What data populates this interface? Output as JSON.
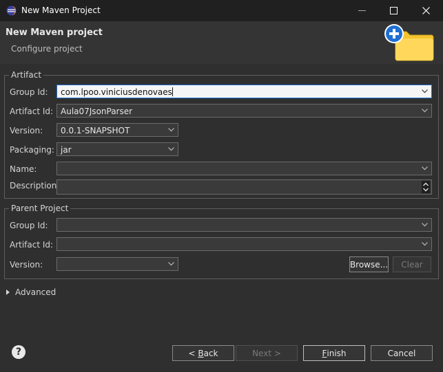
{
  "window": {
    "title": "New Maven Project",
    "minimize_glyph": "—",
    "close_glyph": "✕"
  },
  "header": {
    "title": "New Maven project",
    "subtitle": "Configure project"
  },
  "artifact": {
    "legend": "Artifact",
    "group_id_label": "Group Id:",
    "group_id_value": "com.lpoo.viniciusdenovaes",
    "artifact_id_label": "Artifact Id:",
    "artifact_id_value": "Aula07JsonParser",
    "version_label": "Version:",
    "version_value": "0.0.1-SNAPSHOT",
    "packaging_label": "Packaging:",
    "packaging_value": "jar",
    "name_label": "Name:",
    "name_value": "",
    "description_label": "Description:",
    "description_value": ""
  },
  "parent": {
    "legend": "Parent Project",
    "group_id_label": "Group Id:",
    "group_id_value": "",
    "artifact_id_label": "Artifact Id:",
    "artifact_id_value": "",
    "version_label": "Version:",
    "version_value": "",
    "browse_label": "Browse...",
    "clear_label": "Clear"
  },
  "advanced": {
    "label": "Advanced"
  },
  "footer": {
    "help_glyph": "?",
    "back_prefix": "< ",
    "back_mnemonic": "B",
    "back_rest": "ack",
    "next_label": "Next >",
    "finish_mnemonic": "F",
    "finish_rest": "inish",
    "cancel_label": "Cancel"
  },
  "colors": {
    "background": "#2f2f2f",
    "header": "#343434",
    "focus_border": "#1f6fd1",
    "banner_plus": "#1f6fd1",
    "banner_folder": "#f4c430"
  }
}
